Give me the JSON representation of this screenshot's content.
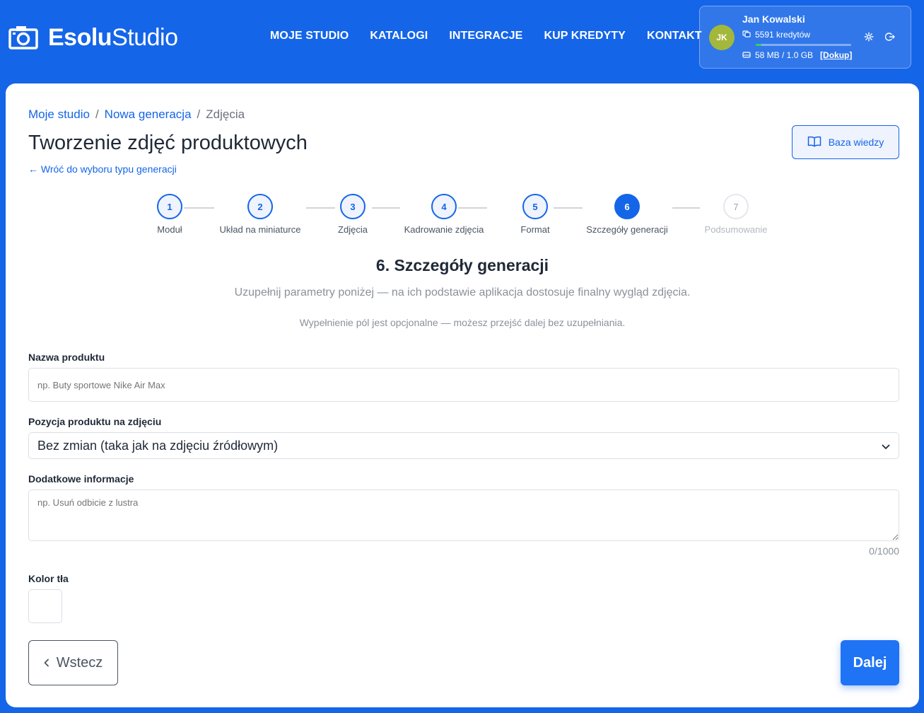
{
  "header": {
    "logo": {
      "bold": "Esolu",
      "light": "Studio"
    },
    "nav": [
      "MOJE STUDIO",
      "KATALOGI",
      "INTEGRACJE",
      "KUP KREDYTY",
      "KONTAKT"
    ],
    "user": {
      "initials": "JK",
      "name": "Jan Kowalski",
      "credits": "5591 kredytów",
      "storage": "58 MB / 1.0 GB",
      "storage_used_fraction": 0.06,
      "topup": "[Dokup]"
    }
  },
  "breadcrumb": [
    "Moje studio",
    "Nowa generacja",
    "Zdjęcia"
  ],
  "page_title": "Tworzenie zdjęć produktowych",
  "back_link": "← Wróć do wyboru typu generacji",
  "knowledge_base": "Baza wiedzy",
  "steps": [
    {
      "num": "1",
      "label": "Moduł",
      "state": "done"
    },
    {
      "num": "2",
      "label": "Układ na miniaturce",
      "state": "done"
    },
    {
      "num": "3",
      "label": "Zdjęcia",
      "state": "done"
    },
    {
      "num": "4",
      "label": "Kadrowanie zdjęcia",
      "state": "done"
    },
    {
      "num": "5",
      "label": "Format",
      "state": "done"
    },
    {
      "num": "6",
      "label": "Szczegóły generacji",
      "state": "active"
    },
    {
      "num": "7",
      "label": "Podsumowanie",
      "state": "pending"
    }
  ],
  "section": {
    "title": "6. Szczegóły generacji",
    "subtitle": "Uzupełnij parametry poniżej — na ich podstawie aplikacja dostosuje finalny wygląd zdjęcia.",
    "note": "Wypełnienie pól jest opcjonalne — możesz przejść dalej bez uzupełniania."
  },
  "form": {
    "product_name_label": "Nazwa produktu",
    "product_name_placeholder": "np. Buty sportowe Nike Air Max",
    "position_label": "Pozycja produktu na zdjęciu",
    "position_value": "Bez zmian (taka jak na zdjęciu źródłowym)",
    "info_label": "Dodatkowe informacje",
    "info_placeholder": "np. Usuń odbicie z lustra",
    "counter": "0/1000",
    "bg_color_label": "Kolor tła",
    "bg_color_value": "#ffffff"
  },
  "buttons": {
    "back": "Wstecz",
    "next": "Dalej"
  },
  "colors": {
    "primary": "#1565e8",
    "background": "#1565e8",
    "success": "#34d058",
    "avatar": "#a3b83a"
  }
}
